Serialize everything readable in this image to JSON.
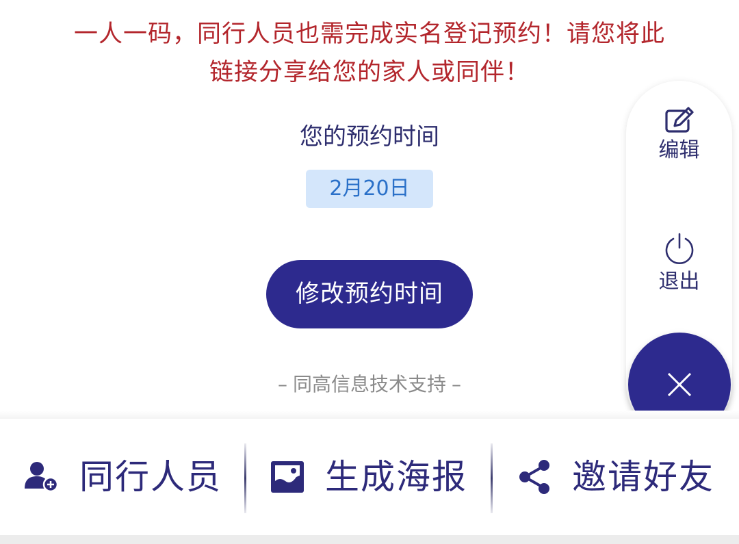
{
  "notice": {
    "line1": "一人一码，同行人员也需完成实名登记预约！请您将此",
    "line2": "链接分享给您的家人或同伴！"
  },
  "reservation": {
    "time_label": "您的预约时间",
    "date": "2月20日",
    "modify_button": "修改预约时间"
  },
  "support": {
    "dash_left": "–",
    "text": "同高信息技术支持",
    "dash_right": "–"
  },
  "side_panel": {
    "edit_label": "编辑",
    "exit_label": "退出"
  },
  "bottom_bar": {
    "companions_label": "同行人员",
    "poster_label": "生成海报",
    "invite_label": "邀请好友"
  },
  "colors": {
    "primary": "#2d2a8e",
    "notice_red": "#b3262c",
    "date_badge_bg": "#d4e6fb",
    "date_text": "#2a70c8"
  },
  "icons": {
    "edit": "edit-icon",
    "exit": "power-icon",
    "close": "close-icon",
    "companions": "add-person-icon",
    "poster": "image-icon",
    "invite": "share-icon"
  }
}
